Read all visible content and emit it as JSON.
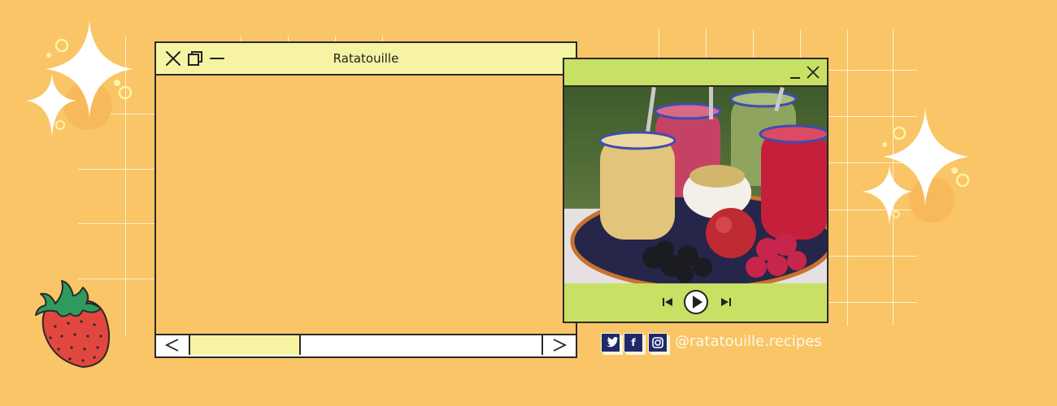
{
  "main_window": {
    "title": "Ratatouille"
  },
  "social": {
    "handle": "@ratatouille.recipes",
    "icons": [
      "twitter-icon",
      "facebook-icon",
      "instagram-icon"
    ],
    "facebook_letter": "f"
  },
  "colors": {
    "background": "#f9c566",
    "titlebar_yellow": "#f6f3a3",
    "player_green": "#c8e063",
    "social_navy": "#1f2a6b"
  }
}
